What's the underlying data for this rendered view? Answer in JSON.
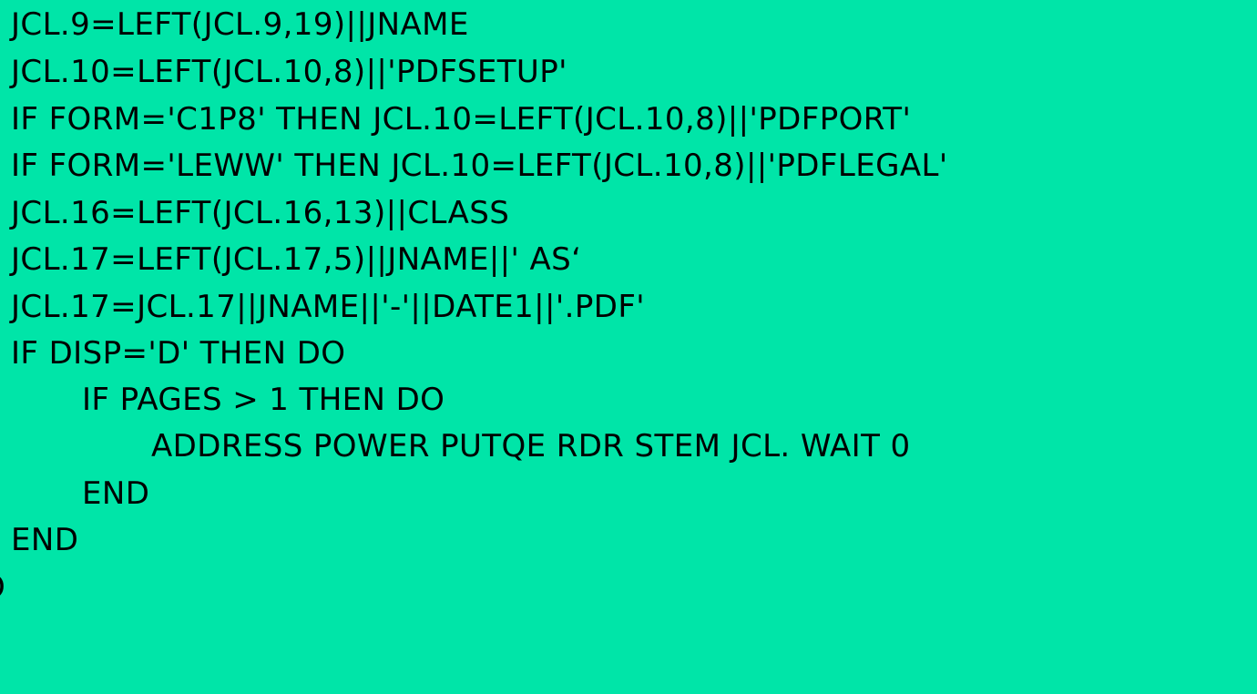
{
  "code": {
    "lines": [
      "JCL.9=LEFT(JCL.9,19)||JNAME",
      "JCL.10=LEFT(JCL.10,8)||'PDFSETUP'",
      "IF FORM='C1P8' THEN JCL.10=LEFT(JCL.10,8)||'PDFPORT'",
      "IF FORM='LEWW' THEN JCL.10=LEFT(JCL.10,8)||'PDFLEGAL'",
      "JCL.16=LEFT(JCL.16,13)||CLASS",
      "JCL.17=LEFT(JCL.17,5)||JNAME||' AS‘",
      "JCL.17=JCL.17||JNAME||'-'||DATE1||'.PDF'",
      "IF DISP='D' THEN DO",
      "IF PAGES > 1 THEN DO",
      "ADDRESS POWER PUTQE RDR STEM JCL. WAIT 0",
      "END",
      "END",
      "O"
    ]
  }
}
